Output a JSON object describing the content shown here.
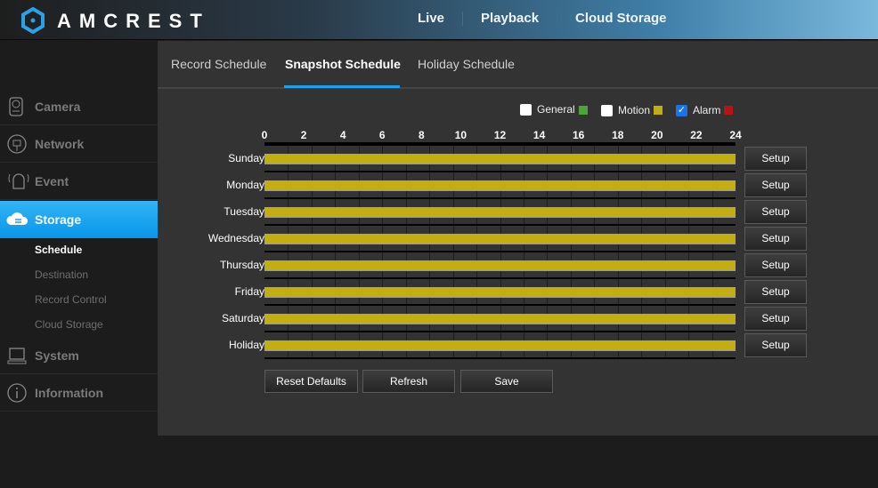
{
  "header": {
    "brand": "AMCREST",
    "nav": [
      "Live",
      "Playback",
      "Cloud Storage"
    ]
  },
  "sidebar": {
    "items": [
      {
        "label": "Camera",
        "icon": "camera-icon"
      },
      {
        "label": "Network",
        "icon": "network-icon"
      },
      {
        "label": "Event",
        "icon": "event-icon"
      },
      {
        "label": "Storage",
        "icon": "cloud-storage-icon",
        "active": true
      },
      {
        "label": "System",
        "icon": "system-icon"
      },
      {
        "label": "Information",
        "icon": "info-icon"
      }
    ],
    "storage_sub": [
      "Schedule",
      "Destination",
      "Record Control",
      "Cloud Storage"
    ]
  },
  "tabs": [
    "Record Schedule",
    "Snapshot Schedule",
    "Holiday Schedule"
  ],
  "legend": [
    {
      "label": "General",
      "checked": false,
      "color": "#4aa536"
    },
    {
      "label": "Motion",
      "checked": false,
      "color": "#c2ae10"
    },
    {
      "label": "Alarm",
      "checked": true,
      "color": "#b51414"
    }
  ],
  "hours": [
    "0",
    "2",
    "4",
    "6",
    "8",
    "10",
    "12",
    "14",
    "16",
    "18",
    "20",
    "22",
    "24"
  ],
  "days": [
    "Sunday",
    "Monday",
    "Tuesday",
    "Wednesday",
    "Thursday",
    "Friday",
    "Saturday",
    "Holiday"
  ],
  "schedule_color": "#c2ae10",
  "setup_label": "Setup",
  "buttons": {
    "reset": "Reset Defaults",
    "refresh": "Refresh",
    "save": "Save"
  }
}
